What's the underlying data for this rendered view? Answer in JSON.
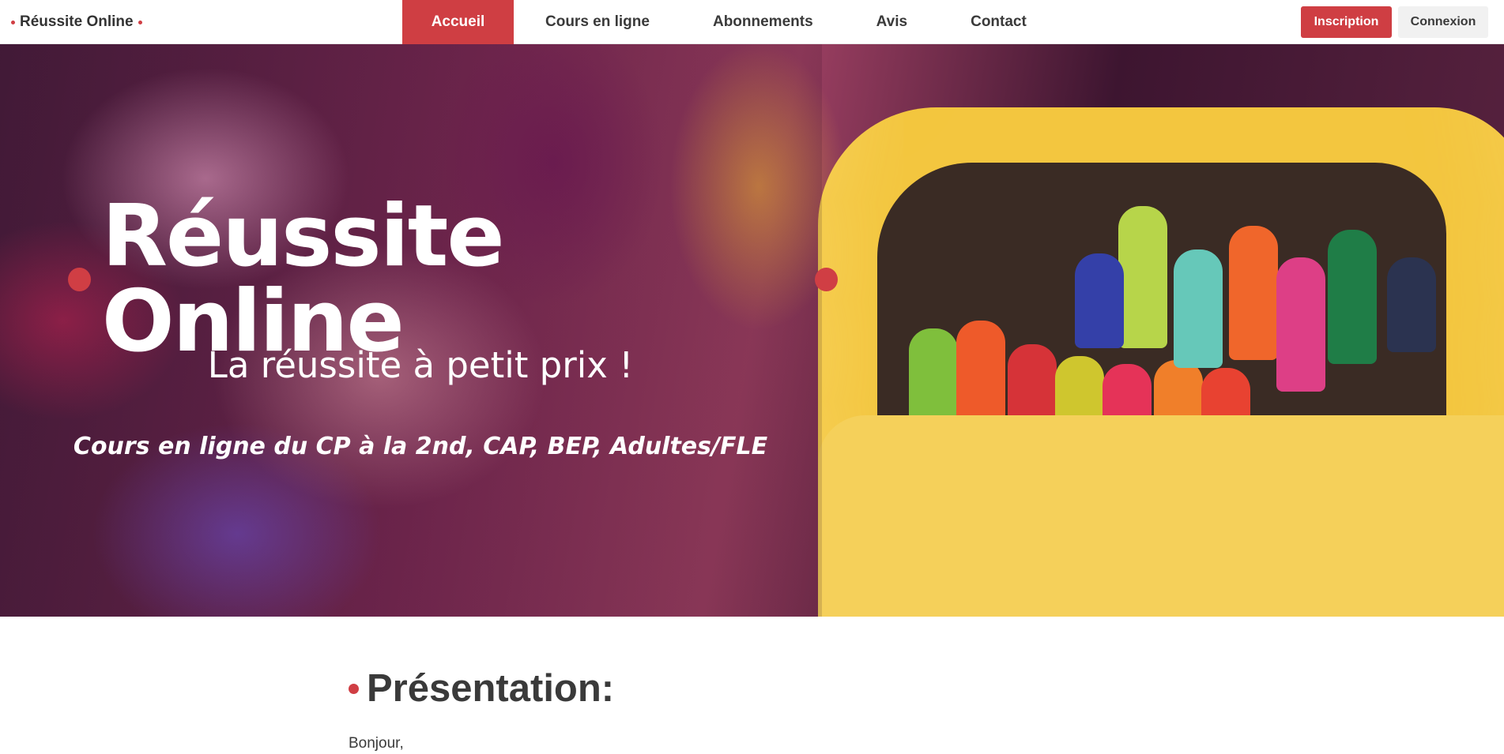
{
  "brand": {
    "name": "Réussite Online"
  },
  "nav": {
    "items": [
      {
        "label": "Accueil",
        "active": true
      },
      {
        "label": "Cours en ligne"
      },
      {
        "label": "Abonnements"
      },
      {
        "label": "Avis"
      },
      {
        "label": "Contact"
      }
    ]
  },
  "auth": {
    "signup_label": "Inscription",
    "login_label": "Connexion"
  },
  "hero": {
    "title": "Réussite Online",
    "subtitle": "La réussite à petit prix !",
    "courses": "Cours en ligne du CP à la 2nd, CAP, BEP, Adultes/FLE"
  },
  "presentation": {
    "heading": "Présentation:",
    "greeting": "Bonjour,"
  },
  "colors": {
    "accent": "#cf3e43",
    "text": "#3a3a3a",
    "box_yellow": "#f3c63f"
  }
}
